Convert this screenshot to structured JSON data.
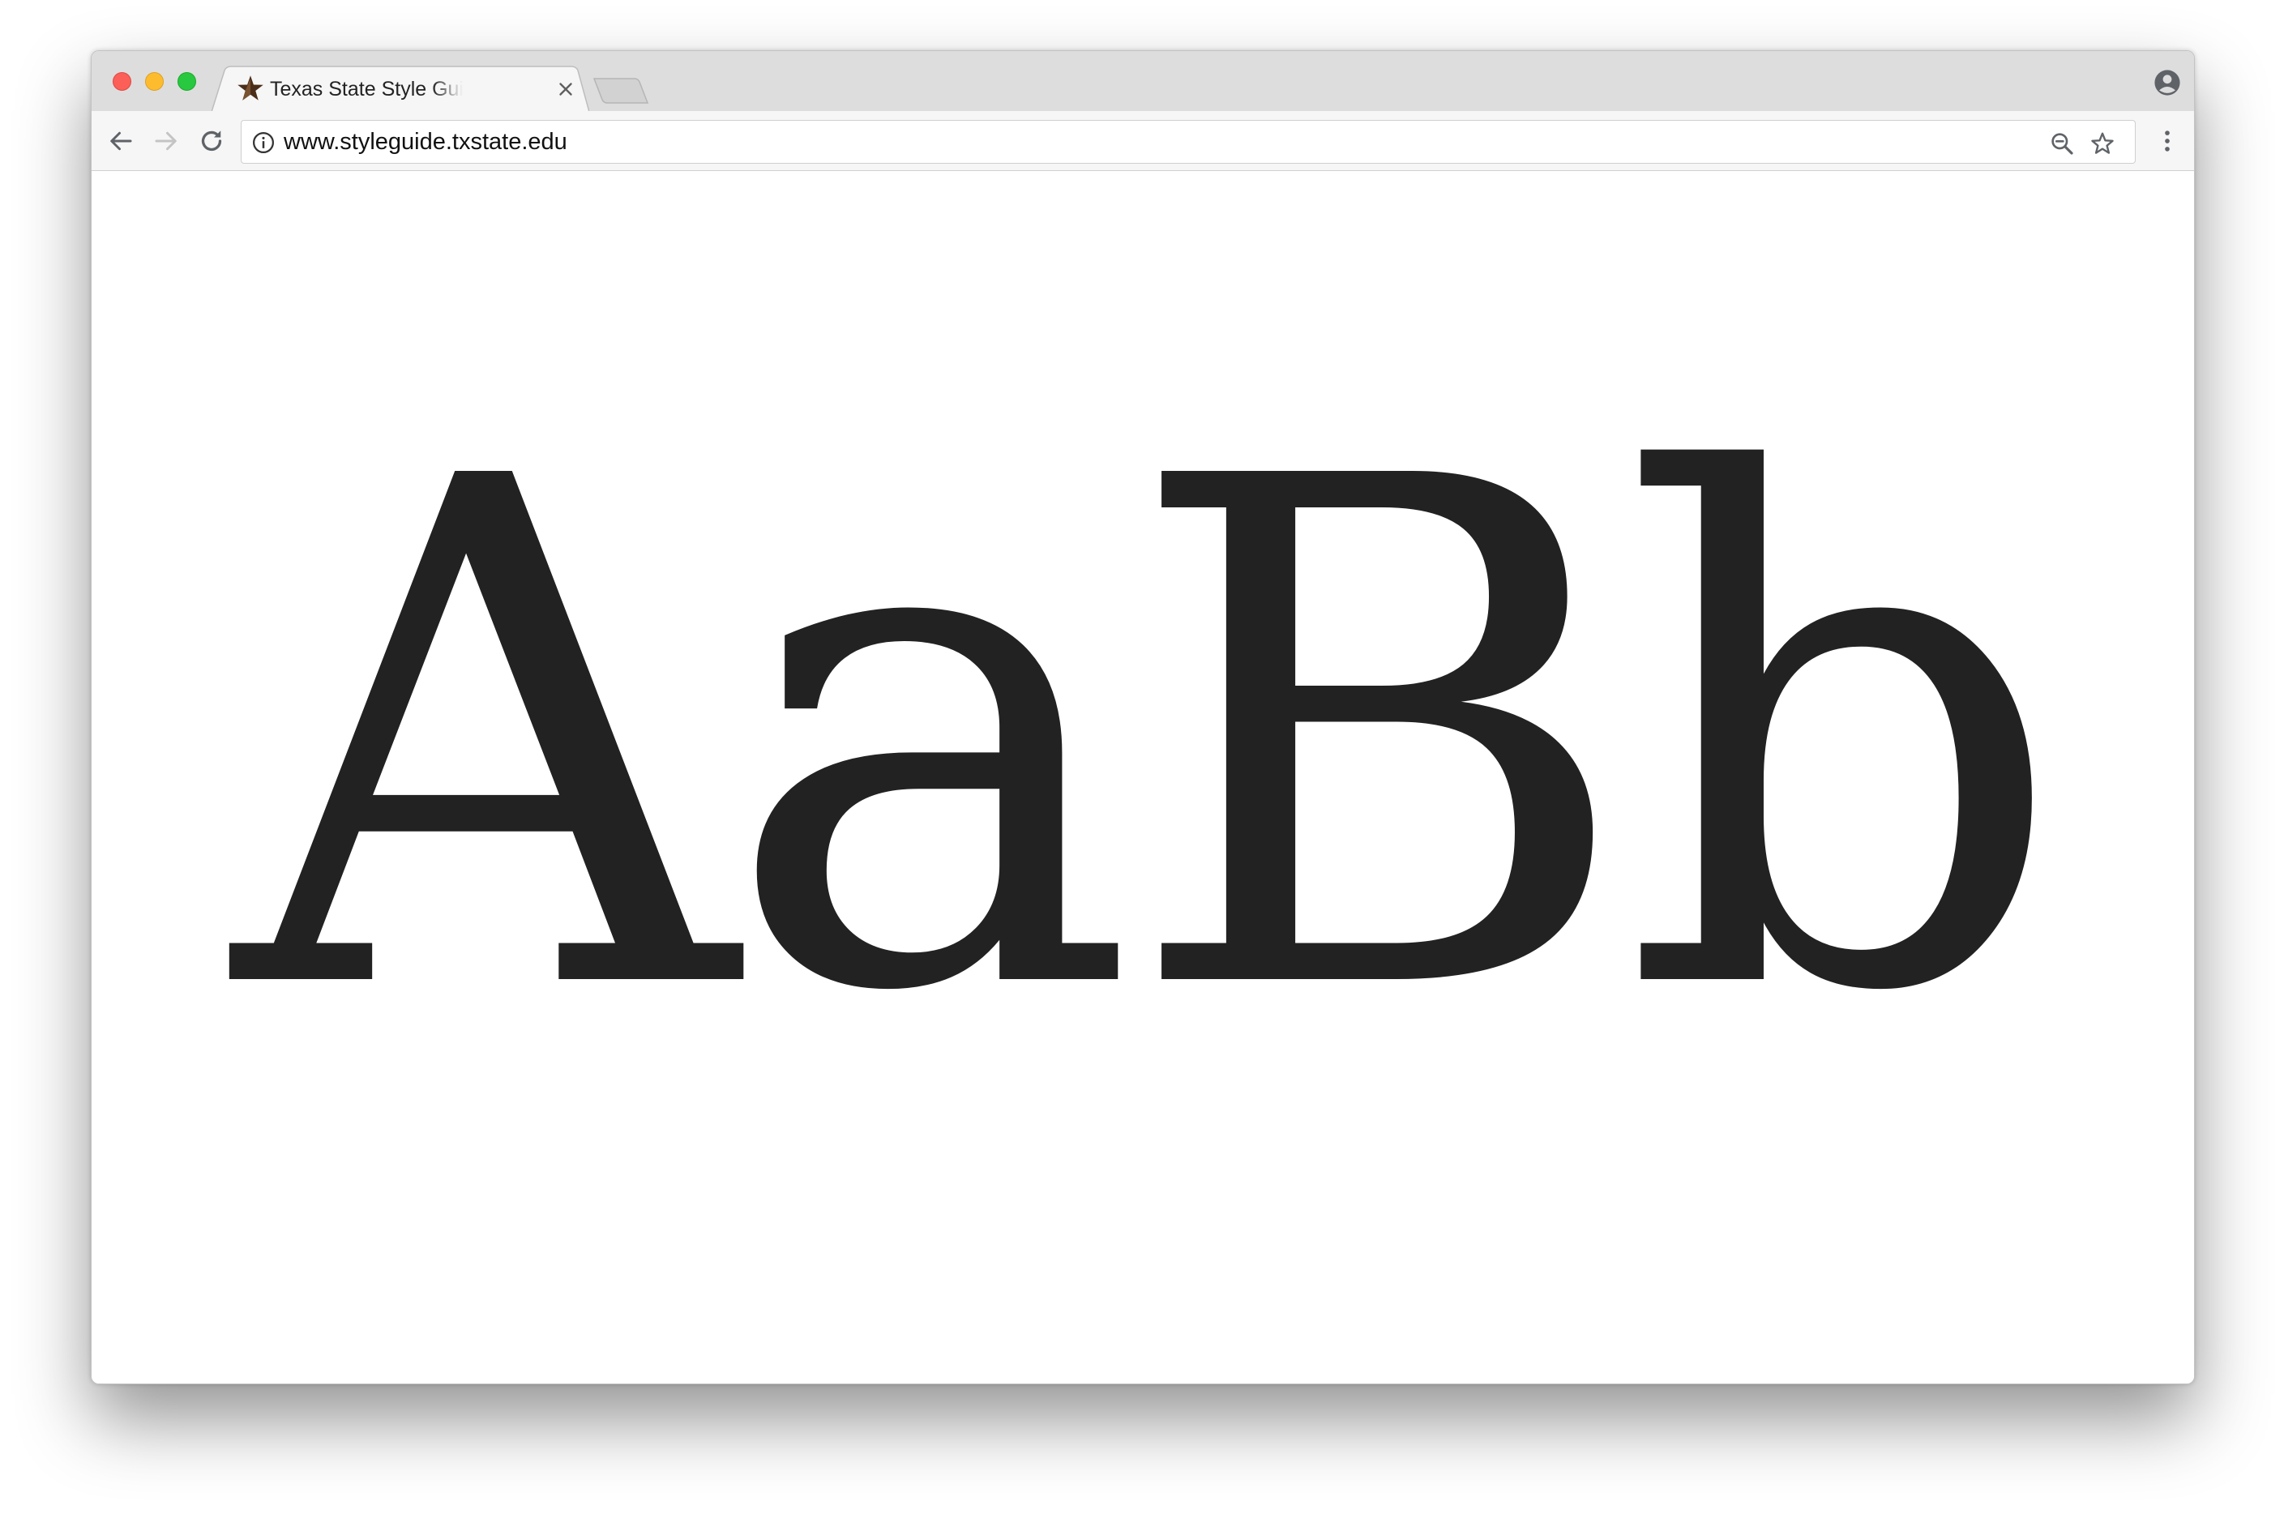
{
  "browser": {
    "tab": {
      "title": "Texas State Style Guide : Texas State University",
      "favicon": "star-favicon-icon"
    },
    "address_bar": {
      "url": "www.styleguide.txstate.edu",
      "site_info_icon": "info-icon"
    },
    "toolbar_icons": [
      "back-arrow-icon",
      "forward-arrow-icon",
      "reload-icon",
      "zoom-out-icon",
      "bookmark-star-icon",
      "more-menu-icon"
    ],
    "profile_icon": "profile-avatar-icon"
  },
  "page": {
    "specimen_text": "AaBb",
    "text_color": "#222222",
    "background_color": "#ffffff"
  },
  "colors": {
    "close": "#fc5f57",
    "minimize": "#fdbc2e",
    "maximize": "#28c840",
    "tab_strip": "#dddddd",
    "toolbar": "#f6f6f6"
  }
}
